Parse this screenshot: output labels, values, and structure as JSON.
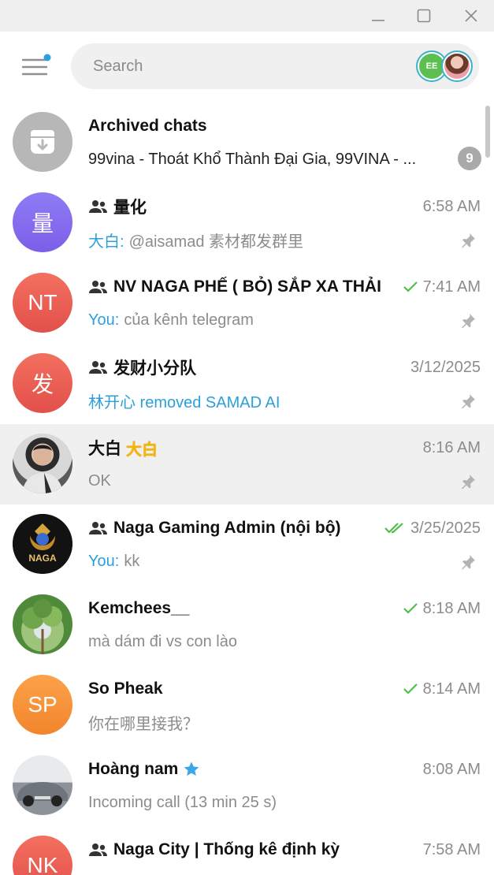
{
  "window": {
    "controls": [
      "minimize-icon",
      "maximize-icon",
      "close-icon"
    ]
  },
  "header": {
    "menu_icon": "hamburger-menu-icon",
    "search_placeholder": "Search",
    "accounts": [
      {
        "initials": "EE",
        "color": "#5cbf50"
      },
      {
        "initials": "",
        "color": "#d88d8d"
      }
    ]
  },
  "colors": {
    "accent_blue": "#2ba0da",
    "check_green": "#4fbf4a",
    "selected_bg": "#f0f0f0"
  },
  "archived": {
    "title": "Archived chats",
    "preview": "99vina - Thoát Khổ Thành Đại Gia, 99VINA - ...",
    "badge": "9"
  },
  "chats": [
    {
      "title": "量化",
      "group": true,
      "time": "6:58 AM",
      "sender": "大白:",
      "preview": "@aisamad 素材都发群里",
      "pinned": true,
      "avatar_text": "量",
      "avatar_color": "#8d6ff0"
    },
    {
      "title": "NV NAGA PHẾ ( BỎ) SẮP XA THẢI",
      "group": true,
      "time": "7:41 AM",
      "check": "single",
      "sender": "You:",
      "preview": "của kênh telegram",
      "pinned": true,
      "avatar_text": "NT",
      "avatar_color": "#ec5f4f"
    },
    {
      "title": "发财小分队",
      "group": true,
      "time": "3/12/2025",
      "sender": "林开心 removed SAMAD AI",
      "preview": "",
      "pinned": true,
      "avatar_text": "发",
      "avatar_color": "#ec5f4f"
    },
    {
      "title": "大白",
      "tag": "大白",
      "group": false,
      "time": "8:16 AM",
      "sender": "",
      "preview": "OK",
      "pinned": true,
      "selected": true,
      "avatar_text": "",
      "avatar_color": "#6e6e6e"
    },
    {
      "title": "Naga Gaming Admin (nội bộ)",
      "group": true,
      "time": "3/25/2025",
      "check": "double",
      "sender": "You:",
      "preview": "kk",
      "pinned": true,
      "avatar_text": "",
      "avatar_color": "#1b1b1b"
    },
    {
      "title": "Kemchees__",
      "group": false,
      "time": "8:18 AM",
      "check": "single",
      "sender": "",
      "preview": "mà dám đi vs con lào",
      "pinned": false,
      "avatar_text": "",
      "avatar_color": "#7fb25c"
    },
    {
      "title": "So Pheak",
      "group": false,
      "time": "8:14 AM",
      "check": "single",
      "sender": "",
      "preview": "你在哪里接我？",
      "pinned": false,
      "avatar_text": "SP",
      "avatar_color": "#f6943a"
    },
    {
      "title": "Hoàng nam",
      "verified": true,
      "group": false,
      "time": "8:08 AM",
      "sender": "",
      "preview": "Incoming call (13 min 25 s)",
      "pinned": false,
      "avatar_text": "",
      "avatar_color": "#8d9299"
    },
    {
      "title": "Naga City | Thống kê định kỳ",
      "group": true,
      "time": "7:58 AM",
      "sender": "",
      "preview": "",
      "pinned": false,
      "avatar_text": "NK",
      "avatar_color": "#ec5f4f"
    }
  ]
}
